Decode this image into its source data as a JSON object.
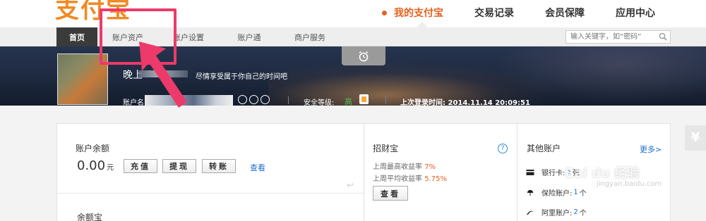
{
  "header": {
    "logo_text": "支付宝",
    "nav": [
      {
        "label": "我的支付宝",
        "active": true
      },
      {
        "label": "交易记录",
        "active": false
      },
      {
        "label": "会员保障",
        "active": false
      },
      {
        "label": "应用中心",
        "active": false
      }
    ]
  },
  "subnav": {
    "items": [
      {
        "label": "首页",
        "active": true
      },
      {
        "label": "账户资产",
        "active": false
      },
      {
        "label": "账户设置",
        "active": false
      },
      {
        "label": "账户通",
        "active": false
      },
      {
        "label": "商户服务",
        "active": false
      }
    ],
    "search_placeholder": "输入关键字，如“密码”"
  },
  "banner": {
    "greeting": "晚上",
    "slogan": "尽情享受属于你自己的时间吧",
    "account_label": "账户名",
    "security_label": "安全等级:",
    "security_level": "高",
    "last_login_label": "上次登录时间:",
    "last_login_time": "2014.11.14 20:09:51"
  },
  "balance_card": {
    "title": "账户余额",
    "amount": "0.00",
    "unit": "元",
    "buttons": [
      "充值",
      "提现",
      "转账"
    ],
    "view_link": "查看",
    "yuebao_title": "余额宝"
  },
  "zhaocaibao": {
    "title": "招财宝",
    "max_yield_label": "上周最高收益率",
    "max_yield": "7%",
    "avg_yield_label": "上周平均收益率",
    "avg_yield": "5.75%",
    "view_button": "查看"
  },
  "other_accounts": {
    "title": "其他账户",
    "more_link": "更多>",
    "rows": [
      {
        "label": "银行卡:",
        "count": "5",
        "suffix": "张"
      },
      {
        "label": "保险账户:",
        "count": "1",
        "suffix": "个"
      },
      {
        "label": "阿里账户:",
        "count": "2",
        "suffix": "个"
      }
    ]
  },
  "side_tab": "¥",
  "watermark": {
    "text": "Bai du 经验",
    "url": "jingyan.baidu.com"
  },
  "colors": {
    "accent": "#e5611f",
    "link": "#1a6fc7",
    "annotation": "#ec3a6b",
    "banner": "#1e2a40"
  }
}
